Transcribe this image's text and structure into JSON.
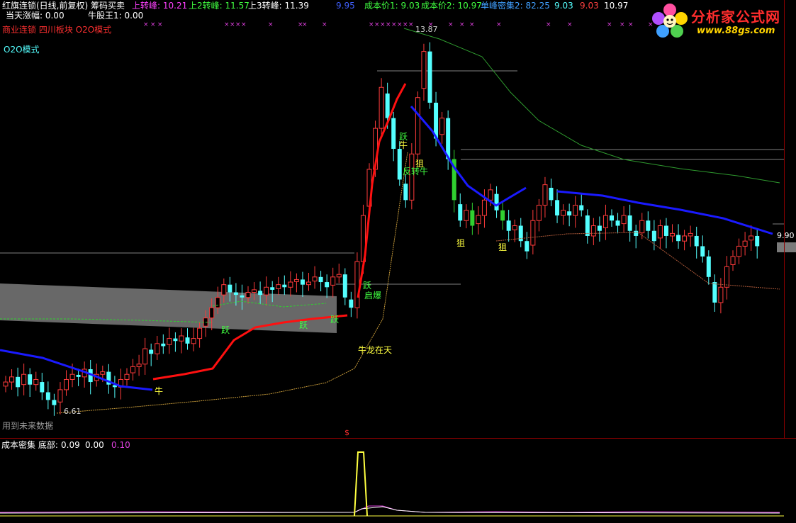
{
  "header": {
    "title": "红旗连锁(日线,前复权) 筹码买卖",
    "today_change": "当天涨幅: 0.00",
    "niu_king": "牛股王1: 0.00",
    "turn1": "上转峰: 10.21",
    "turn2": "上2转峰: 11.57",
    "turn3": "上3转峰: 11.39",
    "v995": "9.95",
    "cost1": "成本价1: 9.03",
    "cost2": "成本价2: 10.97",
    "peak_density": "单峰密集2: 82.25",
    "r1": "9.03",
    "r2": "9.03",
    "r3": "10.97",
    "sector_line": "商业连锁 四川板块 O2O模式",
    "o2o": "O2O模式",
    "future_data": "用到未来数据"
  },
  "labels": {
    "high": "13.87",
    "low": "6.61",
    "right_price": "9.90",
    "dollar": "$",
    "niu1": "牛",
    "niu2": "牛",
    "yue1": "跃",
    "yue2": "跃",
    "yue3": "跃",
    "yue4": "跃",
    "yue5": "跃",
    "qibao": "启爆",
    "niulong": "牛龙在天",
    "fanzhuan": "反转牛",
    "ju1": "狙",
    "ju2": "狙",
    "ju3": "狙"
  },
  "sub_header": {
    "title": "成本密集 底部:",
    "v1": "0.09",
    "v2": "0.00",
    "v3": "0.10"
  },
  "logo": {
    "title": "分析家公式网",
    "url": "www.88gs.com"
  },
  "colors": {
    "up": "#ff3b3b",
    "down": "#54ffff",
    "blue_line": "#1a1aff",
    "red_line": "#ff1010",
    "green_line": "#2f9b2f",
    "orange_dot": "#c79b3a",
    "gray_band": "#7a7a7a",
    "magenta": "#e040e0"
  },
  "chart_data": {
    "type": "candlestick",
    "price_range": [
      6.0,
      14.2
    ],
    "closes": [
      7.05,
      7.15,
      6.95,
      7.2,
      7.0,
      7.1,
      6.85,
      6.7,
      6.6,
      6.9,
      7.1,
      7.2,
      7.15,
      7.3,
      7.05,
      7.2,
      7.25,
      7.0,
      6.95,
      7.1,
      7.2,
      7.35,
      7.4,
      7.7,
      7.6,
      7.8,
      7.75,
      7.9,
      7.85,
      7.95,
      7.8,
      7.9,
      8.1,
      8.3,
      8.5,
      8.7,
      8.95,
      8.8,
      8.75,
      8.7,
      8.8,
      8.85,
      8.75,
      8.9,
      8.85,
      8.95,
      8.9,
      9.0,
      9.05,
      8.95,
      9.0,
      9.1,
      9.0,
      8.9,
      9.1,
      9.15,
      8.7,
      8.5,
      9.4,
      10.3,
      11.2,
      12.0,
      12.8,
      12.2,
      11.6,
      11.0,
      10.6,
      11.5,
      12.6,
      13.5,
      12.5,
      11.8,
      12.2,
      11.4,
      10.6,
      10.2,
      10.4,
      10.1,
      10.3,
      10.6,
      10.8,
      10.4,
      10.2,
      10.0,
      10.1,
      9.8,
      9.6,
      10.2,
      10.5,
      10.9,
      10.6,
      10.3,
      10.4,
      10.3,
      10.5,
      10.4,
      9.9,
      10.1,
      10.0,
      10.3,
      10.2,
      10.1,
      10.3,
      10.0,
      9.9,
      10.2,
      10.0,
      9.8,
      10.1,
      9.9,
      9.95,
      9.8,
      9.9,
      9.95,
      9.7,
      9.5,
      9.1,
      8.6,
      8.9,
      9.3,
      9.5,
      9.7,
      9.8,
      9.9,
      9.7
    ]
  }
}
